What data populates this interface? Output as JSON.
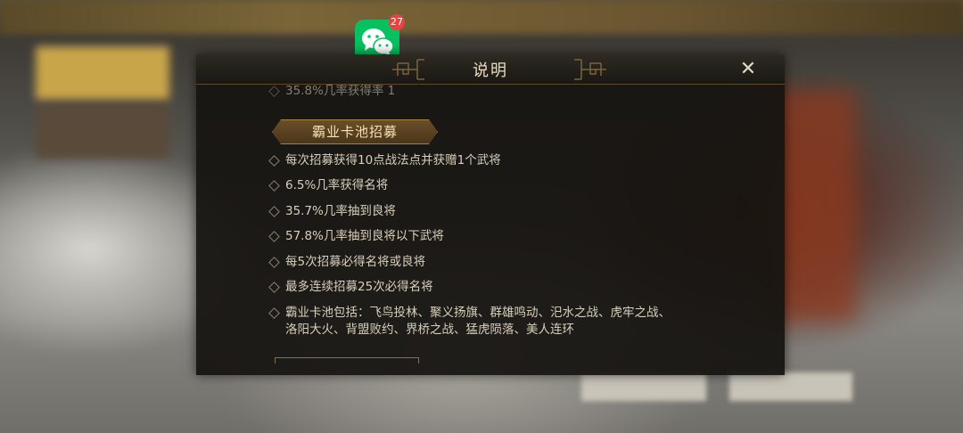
{
  "notification": {
    "app_icon": "wechat-icon",
    "badge_count": "27"
  },
  "dialog": {
    "title": "说明",
    "close_icon": "close-icon",
    "partial_top_line": "35.8%几率获得率 1",
    "section_title": "霸业卡池招募",
    "items": [
      "每次招募获得10点战法点并获赠1个武将",
      "6.5%几率获得名将",
      "35.7%几率抽到良将",
      "57.8%几率抽到良将以下武将",
      "每5次招募必得名将或良将",
      "最多连续招募25次必得名将"
    ],
    "pool_line_1": "霸业卡池包括：飞鸟投林、聚义扬旗、群雄鸣动、汜水之战、虎牢之战、",
    "pool_line_2": "洛阳大火、背盟败约、界桥之战、猛虎陨落、美人连环"
  },
  "colors": {
    "dialog_bg": "#161411",
    "title_text": "#e8dcc0",
    "section_gold": "#a6853e",
    "body_text": "#d8cfbc",
    "wechat_green": "#07c160",
    "badge_red": "#e64340"
  }
}
